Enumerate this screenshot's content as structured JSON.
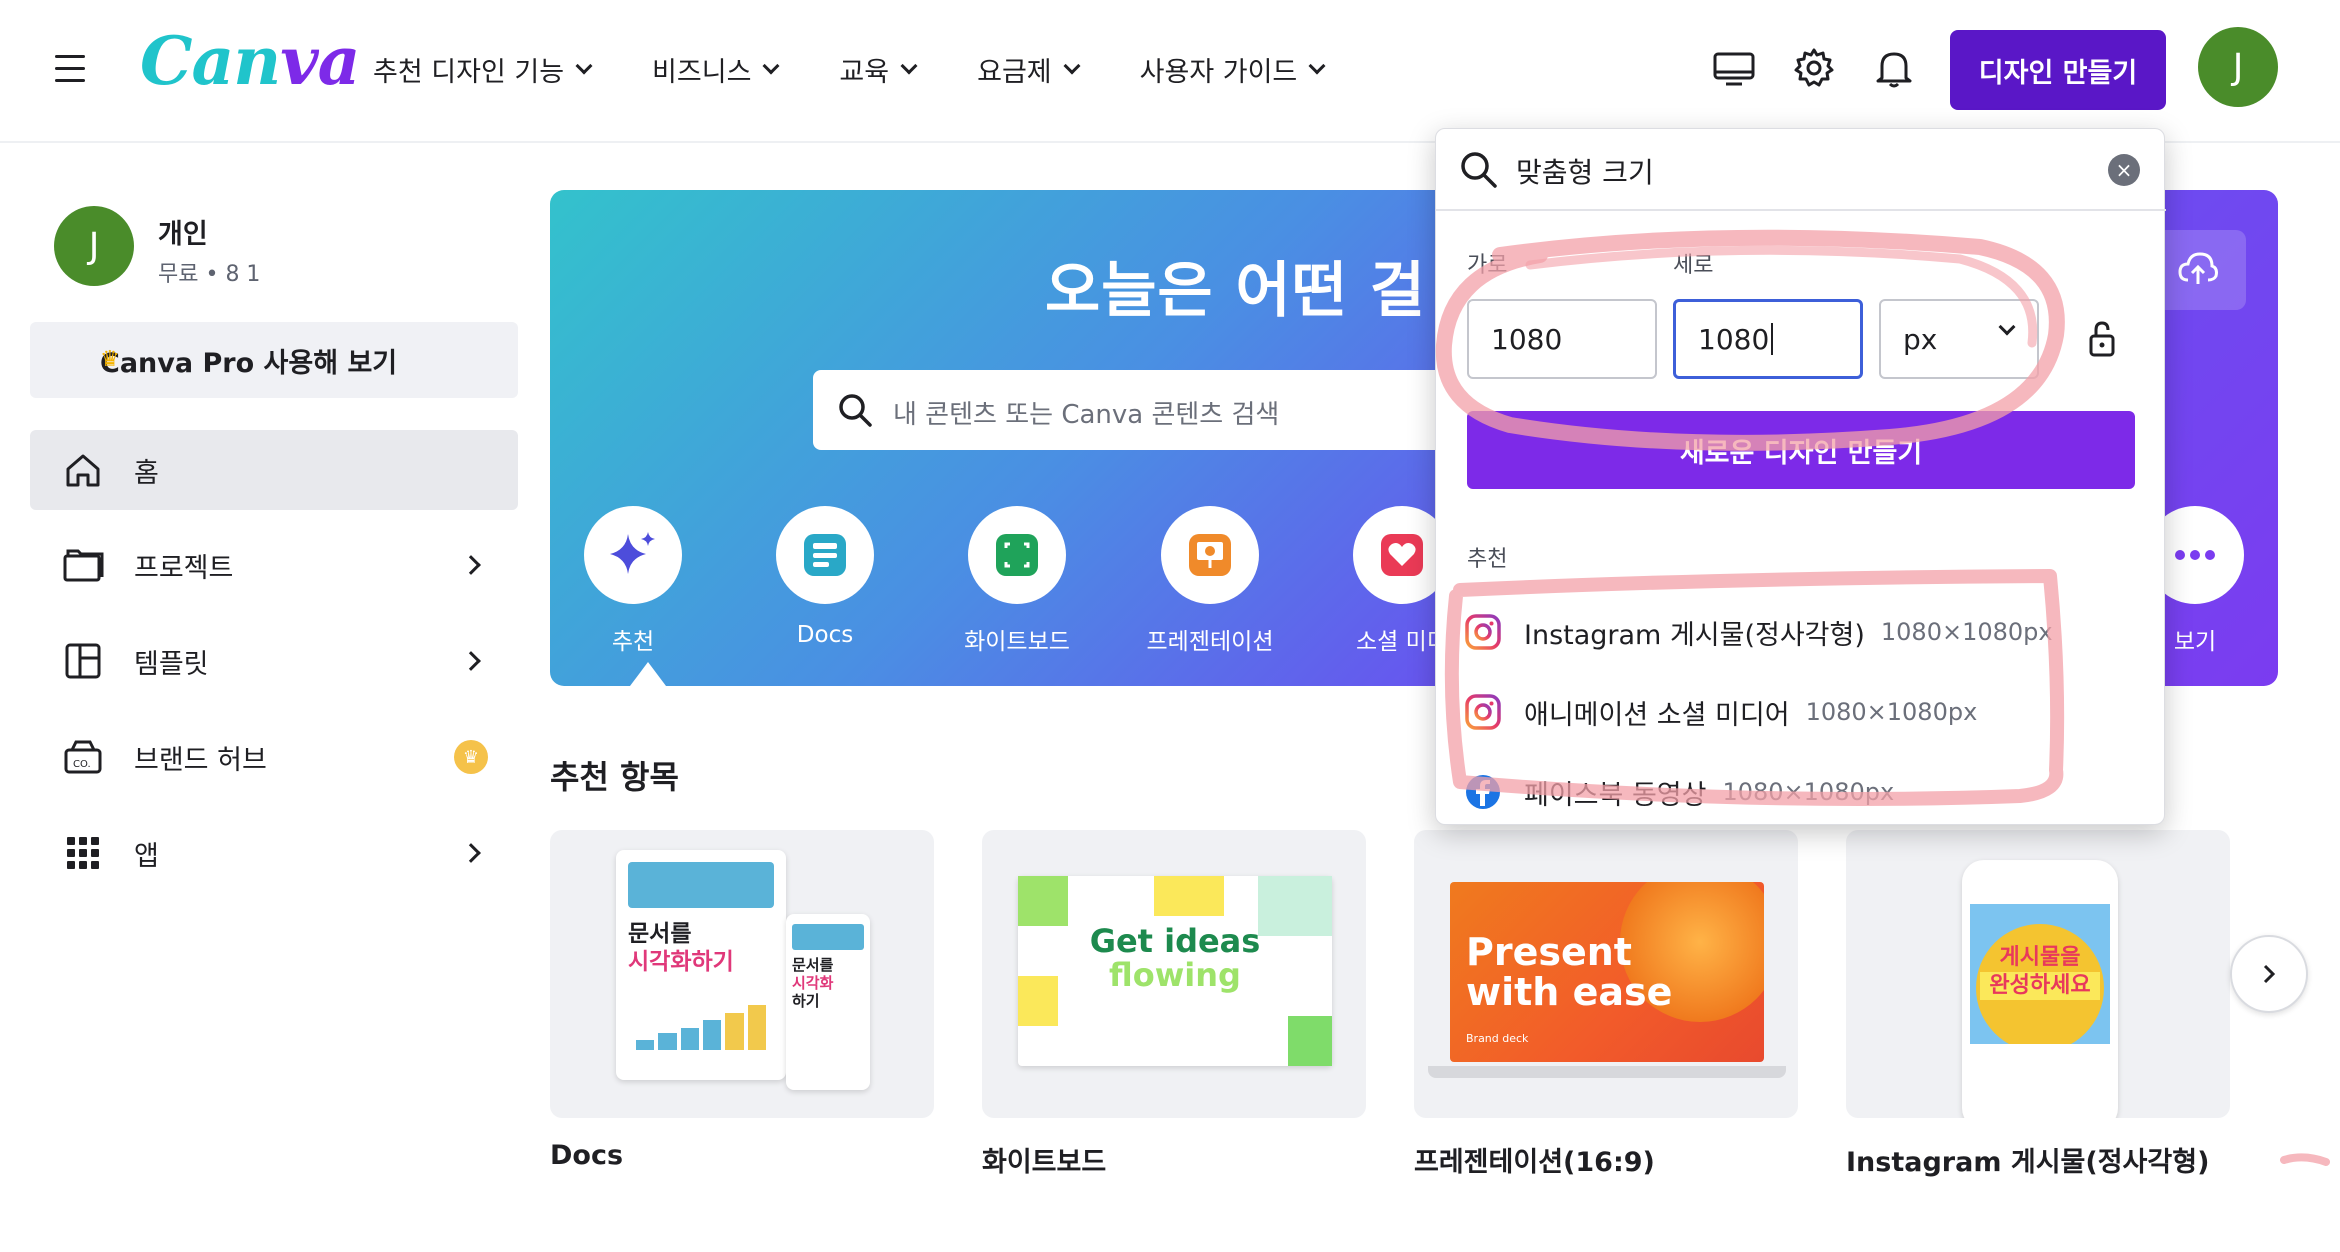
{
  "header": {
    "logo": "Canva",
    "nav": [
      {
        "label": "추천 디자인 기능"
      },
      {
        "label": "비즈니스"
      },
      {
        "label": "교육"
      },
      {
        "label": "요금제"
      },
      {
        "label": "사용자 가이드"
      }
    ],
    "create_button": "디자인 만들기",
    "avatar_initial": "J"
  },
  "sidebar": {
    "avatar_initial": "J",
    "account_name": "개인",
    "account_plan": "무료 • 8 1",
    "pro_button": "Canva Pro 사용해 보기",
    "items": [
      {
        "label": "홈"
      },
      {
        "label": "프로젝트"
      },
      {
        "label": "템플릿"
      },
      {
        "label": "브랜드 허브"
      },
      {
        "label": "앱"
      }
    ]
  },
  "banner": {
    "title": "오늘은 어떤 걸 디",
    "search_placeholder": "내 콘텐츠 또는 Canva 콘텐츠 검색",
    "categories": [
      {
        "label": "추천"
      },
      {
        "label": "Docs"
      },
      {
        "label": "화이트보드"
      },
      {
        "label": "프레젠테이션"
      },
      {
        "label": "소셜 미디"
      },
      {
        "label": "보기"
      }
    ]
  },
  "recommended": {
    "title": "추천 항목",
    "cards": [
      {
        "label": "Docs",
        "thumb_text_1": "문서를",
        "thumb_text_2": "시각화하기",
        "thumb_small_1": "문서를",
        "thumb_small_2": "시각화",
        "thumb_small_3": "하기"
      },
      {
        "label": "화이트보드",
        "thumb_text_1": "Get ideas",
        "thumb_text_2": "flowing"
      },
      {
        "label": "프레젠테이션(16:9)",
        "thumb_text_1": "Present",
        "thumb_text_2": "with ease",
        "thumb_small": "Brand deck"
      },
      {
        "label": "Instagram 게시물(정사각형)",
        "thumb_text_1": "게시물을",
        "thumb_text_2": "완성하세요"
      }
    ]
  },
  "size_dropdown": {
    "search_value": "맞춤형 크기",
    "width_label": "가로",
    "height_label": "세로",
    "width_value": "1080",
    "height_value": "1080",
    "unit": "px",
    "create_button": "새로운 디자인 만들기",
    "recommended_label": "추천",
    "suggestions": [
      {
        "name": "Instagram 게시물(정사각형)",
        "size": "1080×1080px",
        "icon": "instagram-icon"
      },
      {
        "name": "애니메이션 소셜 미디어",
        "size": "1080×1080px",
        "icon": "instagram-icon"
      },
      {
        "name": "페이스북 동영상",
        "size": "1080×1080px",
        "icon": "facebook-icon"
      }
    ]
  },
  "colors": {
    "brand_purple": "#7d2ae8",
    "create_button": "#5a17c7",
    "avatar_green": "#4a8c2a",
    "highlight_pink": "#f3a0a8"
  }
}
